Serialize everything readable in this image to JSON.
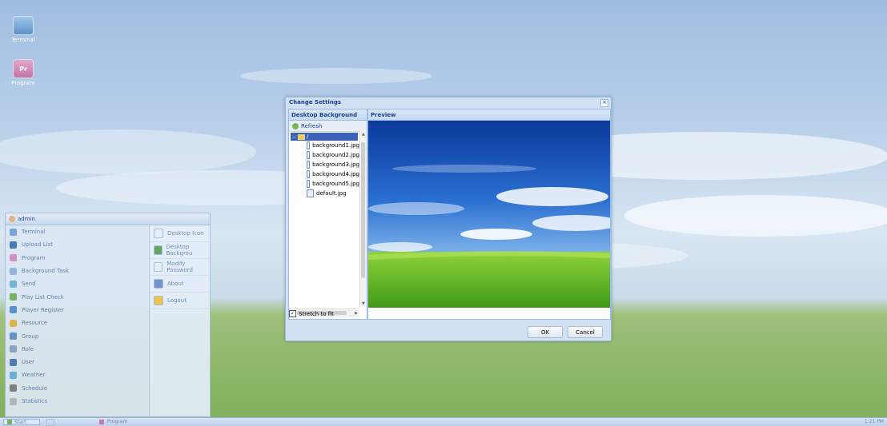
{
  "desktop": {
    "icons": [
      {
        "label": "Terminal",
        "glyph": ""
      },
      {
        "label": "Program",
        "glyph": "Pr"
      }
    ]
  },
  "start_menu": {
    "user": "admin",
    "left_items": [
      "Terminal",
      "Upload List",
      "Program",
      "Background Task",
      "Send",
      "Play List Check",
      "Player Register",
      "Resource",
      "Group",
      "Role",
      "User",
      "Weather",
      "Schedule",
      "Statistics"
    ],
    "left_icon_colors": [
      "#6fa0d8",
      "#3e74b8",
      "#d38bc2",
      "#8fb1dd",
      "#68b6d3",
      "#6cb257",
      "#4f8fd1",
      "#e0b34c",
      "#5f8fc9",
      "#8aa4c6",
      "#4d78b9",
      "#66b1e4",
      "#7c7c7c",
      "#b9b9b9"
    ],
    "right_items": [
      "Desktop Icon",
      "Desktop Backgrou",
      "Modify Password",
      "About",
      "Logout"
    ]
  },
  "taskbar": {
    "start_label": "Start",
    "task_label": "Program",
    "clock": "1:21 PM"
  },
  "dialog": {
    "title": "Change Settings",
    "close_glyph": "×",
    "left_header": "Desktop Background",
    "refresh_label": "Refresh",
    "root_label": "/",
    "files": [
      "background1.jpg",
      "background2.jpg",
      "background3.jpg",
      "background4.jpg",
      "background5.jpg",
      "default.jpg"
    ],
    "preview_header": "Preview",
    "stretch_label": "Stretch to fit",
    "stretch_checked": "✓",
    "ok_label": "OK",
    "cancel_label": "Cancel"
  }
}
